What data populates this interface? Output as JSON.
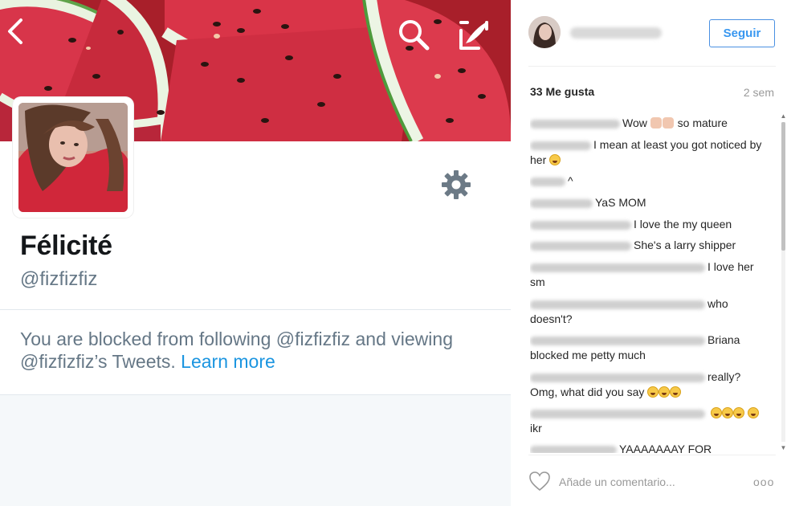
{
  "twitter": {
    "display_name": "Félicité",
    "handle": "@fizfizfiz",
    "blocked_message": "You are blocked from following @fizfizfiz and viewing @fizfizfiz’s Tweets.",
    "learn_more": "Learn more",
    "icons": [
      "back-arrow-icon",
      "search-icon",
      "compose-icon",
      "gear-icon"
    ]
  },
  "instagram": {
    "follow_label": "Seguir",
    "likes": "33 Me gusta",
    "time_ago": "2 sem",
    "comments": [
      {
        "text": "Wow",
        "suffix": "so mature"
      },
      {
        "text": "I mean at least you got noticed by her"
      },
      {
        "text": "^"
      },
      {
        "text": "YaS MOM"
      },
      {
        "text": "I love the my queen"
      },
      {
        "text": "She's a larry shipper"
      },
      {
        "text": "I love her sm"
      },
      {
        "text": "who doesn't?"
      },
      {
        "text": "Briana blocked me petty much"
      },
      {
        "text": "really? Omg, what did you say"
      },
      {
        "text": "ikr"
      },
      {
        "text": "YAAAAAAAY FOR"
      }
    ],
    "comment_placeholder": "Añade un comentario...",
    "more_label": "ooo"
  },
  "colors": {
    "twitter_link": "#1b95e0",
    "twitter_muted": "#657786",
    "instagram_blue": "#3897f0",
    "banner_red": "#b72430"
  }
}
